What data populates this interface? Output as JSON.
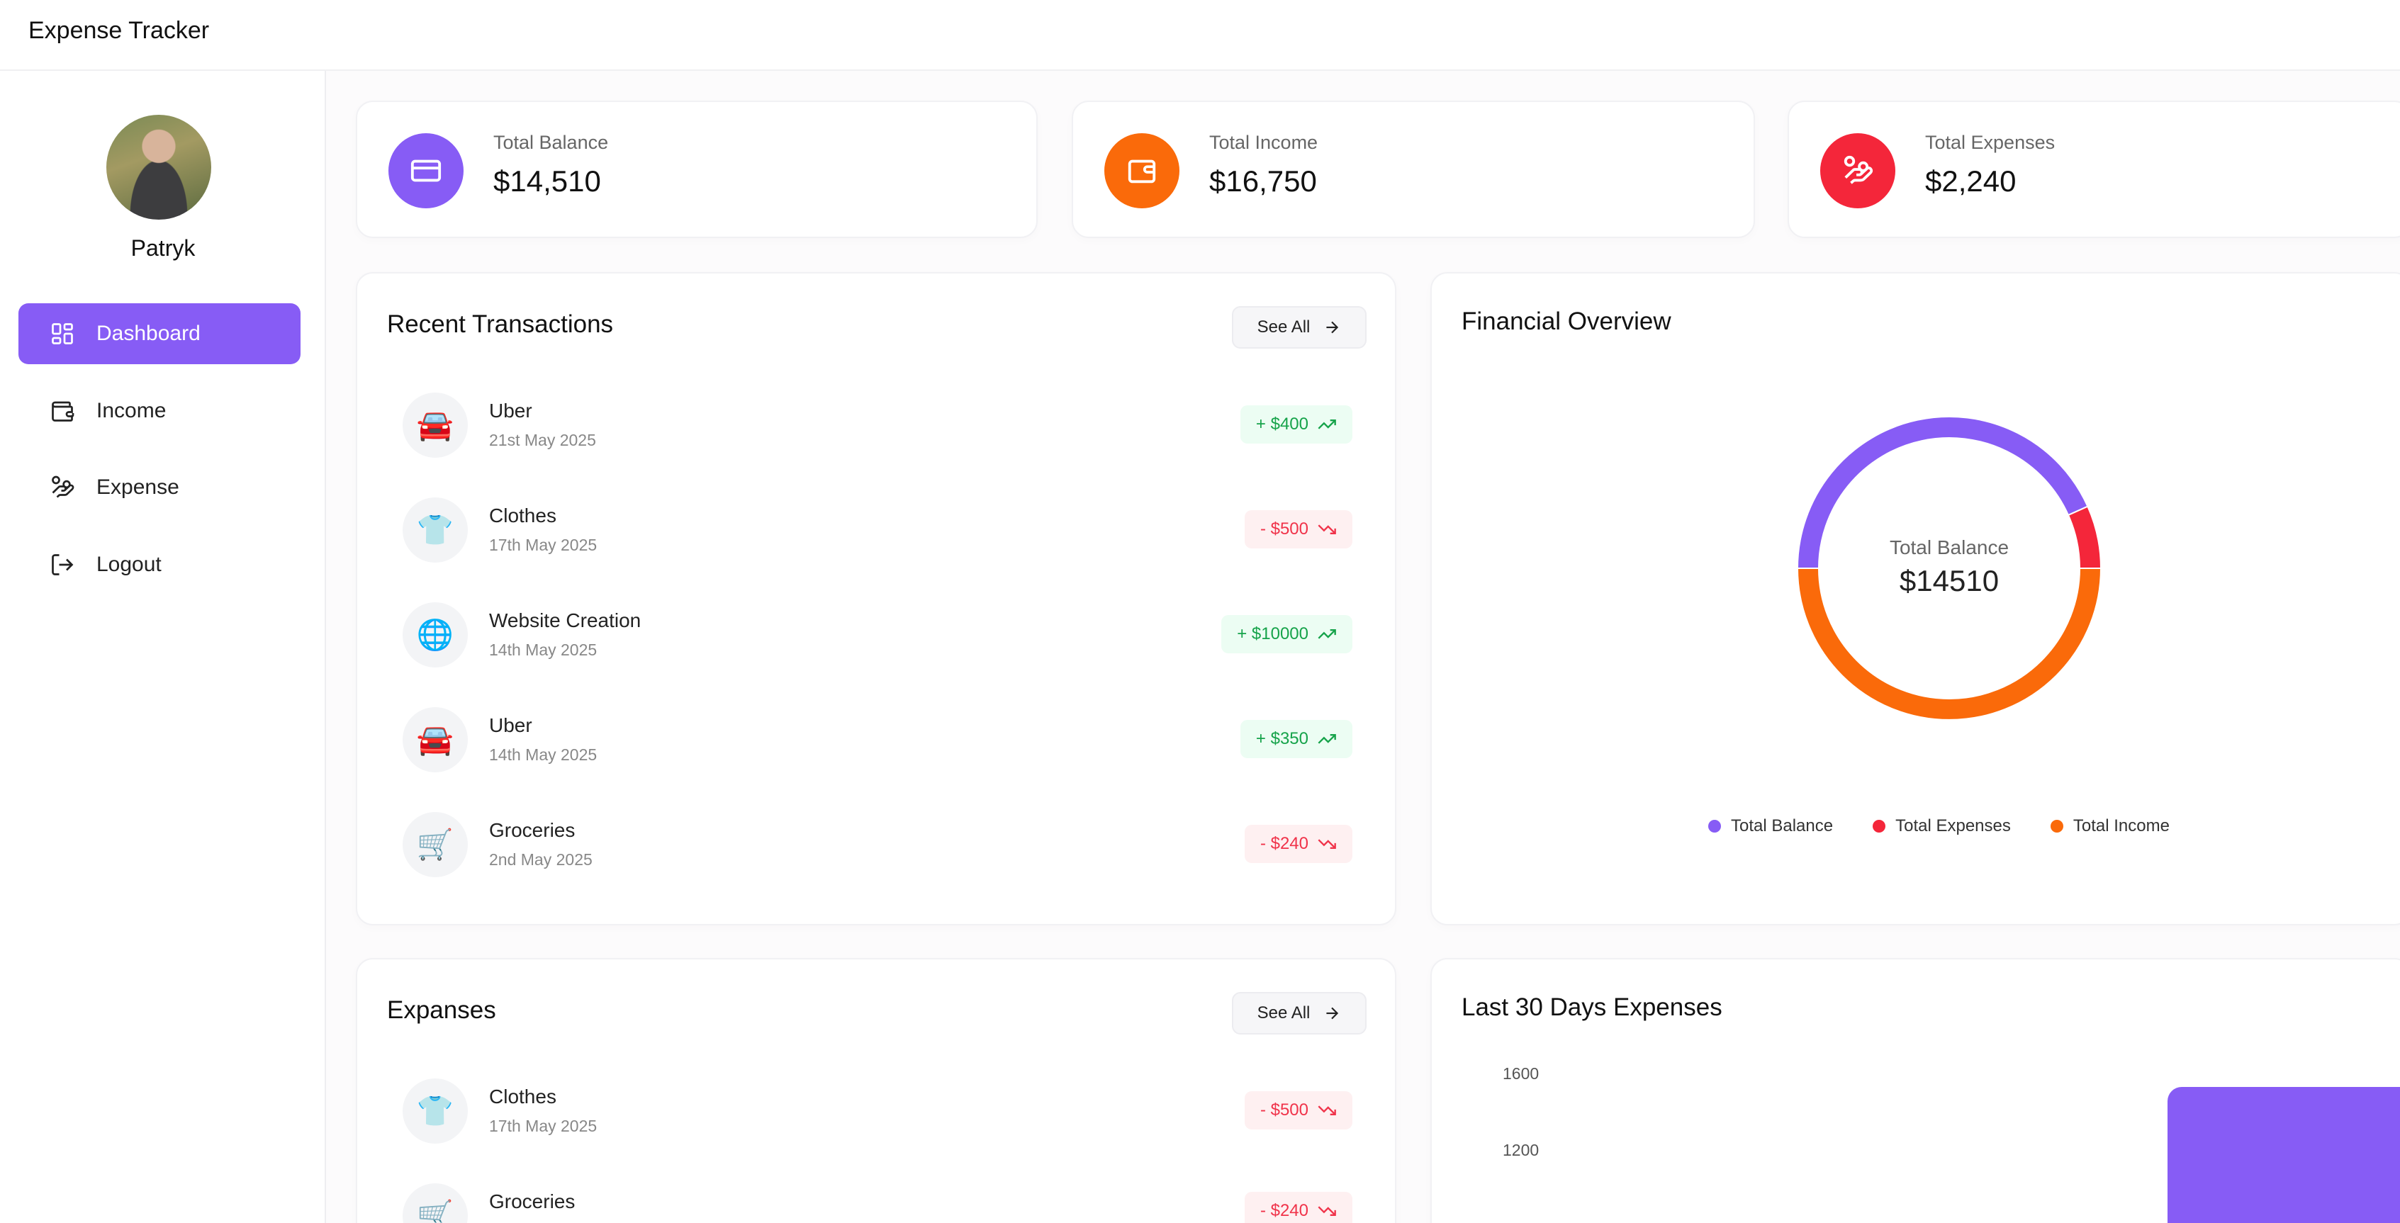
{
  "app": {
    "title": "Expense Tracker"
  },
  "user": {
    "name": "Patryk"
  },
  "sidebar": {
    "items": [
      {
        "label": "Dashboard",
        "icon": "dashboard-icon",
        "active": true
      },
      {
        "label": "Income",
        "icon": "wallet-icon"
      },
      {
        "label": "Expense",
        "icon": "hand-coins-icon"
      },
      {
        "label": "Logout",
        "icon": "logout-icon"
      }
    ]
  },
  "stats": [
    {
      "label": "Total Balance",
      "value": "$14,510",
      "color": "#875cf5",
      "icon": "credit-card-icon"
    },
    {
      "label": "Total Income",
      "value": "$16,750",
      "color": "#fa6a0a",
      "icon": "wallet-icon"
    },
    {
      "label": "Total Expenses",
      "value": "$2,240",
      "color": "#f4263a",
      "icon": "hand-coins-icon"
    }
  ],
  "recent": {
    "title": "Recent Transactions",
    "see_all": "See All",
    "items": [
      {
        "name": "Uber",
        "date": "21st May 2025",
        "amount": "+ $400",
        "type": "income",
        "emoji": "🚘"
      },
      {
        "name": "Clothes",
        "date": "17th May 2025",
        "amount": "- $500",
        "type": "expense",
        "emoji": "👕"
      },
      {
        "name": "Website Creation",
        "date": "14th May 2025",
        "amount": "+ $10000",
        "type": "income",
        "emoji": "🌐"
      },
      {
        "name": "Uber",
        "date": "14th May 2025",
        "amount": "+ $350",
        "type": "income",
        "emoji": "🚘"
      },
      {
        "name": "Groceries",
        "date": "2nd May 2025",
        "amount": "- $240",
        "type": "expense",
        "emoji": "🛒"
      }
    ]
  },
  "overview": {
    "title": "Financial Overview",
    "center_label": "Total Balance",
    "center_value": "$14510",
    "chart_data": {
      "type": "pie",
      "categories": [
        "Total Balance",
        "Total Expenses",
        "Total Income"
      ],
      "values": [
        14510,
        2240,
        16750
      ],
      "colors": [
        "#875cf5",
        "#f4263a",
        "#fa6a0a"
      ],
      "legend": "bottom"
    }
  },
  "expenses": {
    "title": "Expanses",
    "see_all": "See All",
    "items": [
      {
        "name": "Clothes",
        "date": "17th May 2025",
        "amount": "- $500",
        "type": "expense",
        "emoji": "👕"
      },
      {
        "name": "Groceries",
        "date": "",
        "amount": "- $240",
        "type": "expense",
        "emoji": "🛒"
      }
    ]
  },
  "last30": {
    "title": "Last 30 Days Expenses",
    "y_ticks": [
      "1600",
      "1200"
    ],
    "bar_color": "#875cf5"
  }
}
